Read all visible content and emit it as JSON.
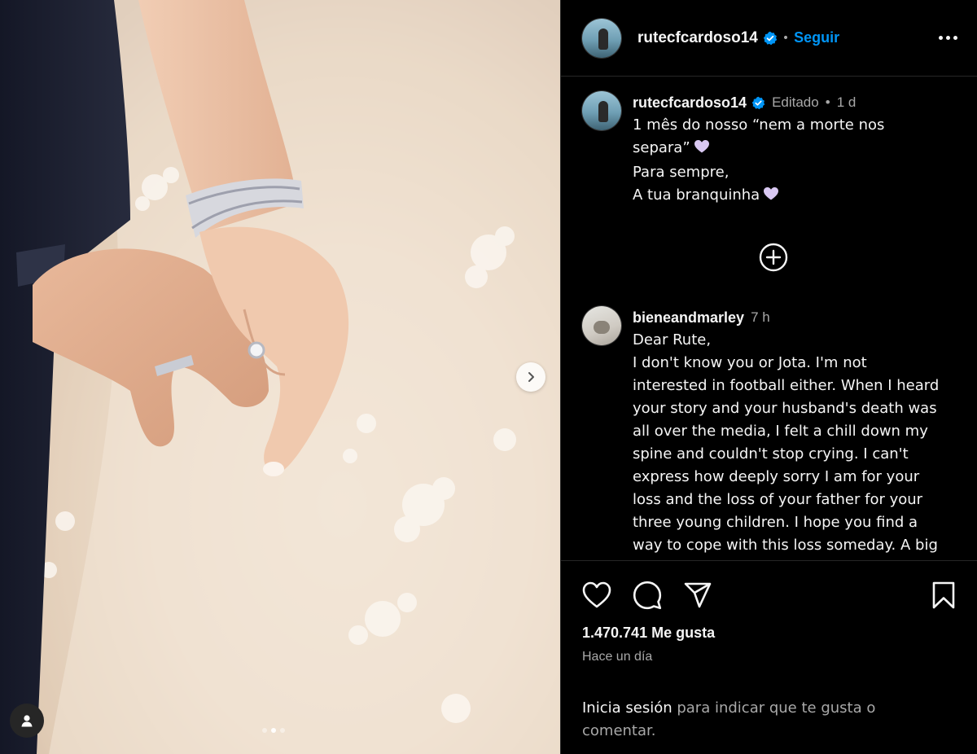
{
  "post": {
    "username": "rutecfcardoso14",
    "follow_label": "Seguir",
    "separator": "•",
    "photo_dots": [
      false,
      true,
      false
    ]
  },
  "caption": {
    "username": "rutecfcardoso14",
    "edited": "Editado",
    "sep": "•",
    "age": "1 d",
    "lines": [
      "1 mês do nosso “nem a morte nos",
      "separa”",
      "Para sempre,",
      "A tua branquinha"
    ]
  },
  "comment": {
    "username": "bieneandmarley",
    "age": "7 h",
    "lines": [
      "Dear Rute,",
      "I don't know you or Jota. I'm not",
      "interested in football either. When I heard",
      "your story and your husband's death was",
      "all over the media, I felt a chill down my",
      "spine and couldn't stop crying. I can't",
      "express how deeply sorry I am for your",
      "loss and the loss of your father for your",
      "three young children. I hope you find a",
      "way to cope with this loss someday. A big"
    ]
  },
  "stats": {
    "likes": "1.470.741 Me gusta",
    "time": "Hace un día"
  },
  "login": {
    "link": "Inicia sesión",
    "rest": " para indicar que te gusta o",
    "rest2": "comentar."
  },
  "icons": {
    "like": "heart-icon",
    "comment": "comment-icon",
    "share": "share-icon",
    "save": "bookmark-icon",
    "more": "more-icon",
    "add": "add-circle-icon",
    "next": "chevron-right-icon",
    "user": "user-tag-icon",
    "verified": "verified-badge-icon"
  },
  "colors": {
    "accent": "#0095f6",
    "verified": "#0095f6",
    "heart_emoji": "#d9c8f2"
  }
}
